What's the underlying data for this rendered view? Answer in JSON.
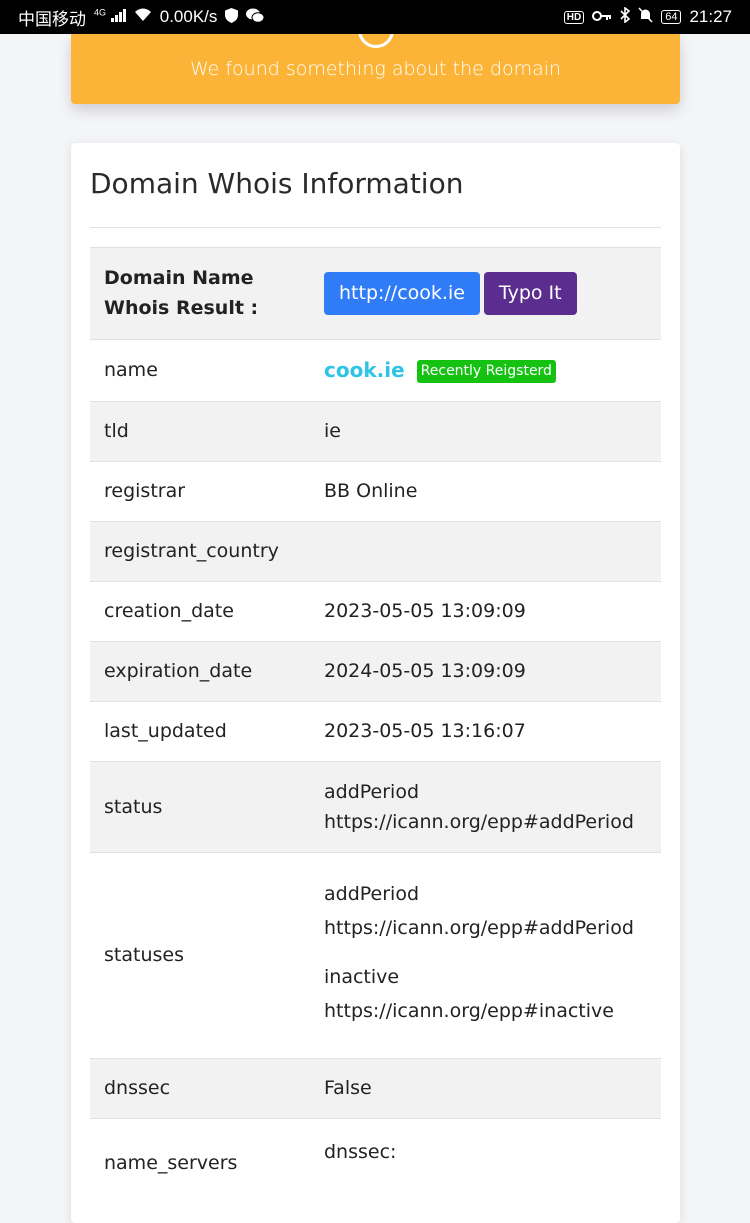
{
  "status_bar": {
    "carrier": "中国移动",
    "network": "4G",
    "speed": "0.00K/s",
    "battery": "64",
    "time": "21:27",
    "icons": [
      "signal-icon",
      "wifi-icon",
      "shield-icon",
      "wechat-icon",
      "hd-icon",
      "key-icon",
      "bluetooth-icon",
      "mute-bell-icon",
      "battery-icon"
    ]
  },
  "banner": {
    "message": "We found something about the domain",
    "color": "#fbb437"
  },
  "card": {
    "title": "Domain Whois Information",
    "header_label": "Domain Name Whois Result :",
    "url_button": "http://cook.ie",
    "typo_button": "Typo It",
    "rows": {
      "name": {
        "key": "name",
        "value": "cook.ie",
        "badge": "Recently Reigsterd"
      },
      "tld": {
        "key": "tld",
        "value": "ie"
      },
      "registrar": {
        "key": "registrar",
        "value": "BB Online"
      },
      "registrant_country": {
        "key": "registrant_country",
        "value": ""
      },
      "creation_date": {
        "key": "creation_date",
        "value": "2023-05-05 13:09:09"
      },
      "expiration_date": {
        "key": "expiration_date",
        "value": "2024-05-05 13:09:09"
      },
      "last_updated": {
        "key": "last_updated",
        "value": "2023-05-05 13:16:07"
      },
      "status": {
        "key": "status",
        "line1": "addPeriod",
        "line2": "https://icann.org/epp#addPeriod"
      },
      "statuses": {
        "key": "statuses",
        "items": [
          {
            "line1": "addPeriod",
            "line2": "https://icann.org/epp#addPeriod"
          },
          {
            "line1": "inactive",
            "line2": "https://icann.org/epp#inactive"
          }
        ]
      },
      "dnssec": {
        "key": "dnssec",
        "value": "False"
      },
      "name_servers": {
        "key": "name_servers",
        "value": "dnssec:"
      }
    }
  }
}
